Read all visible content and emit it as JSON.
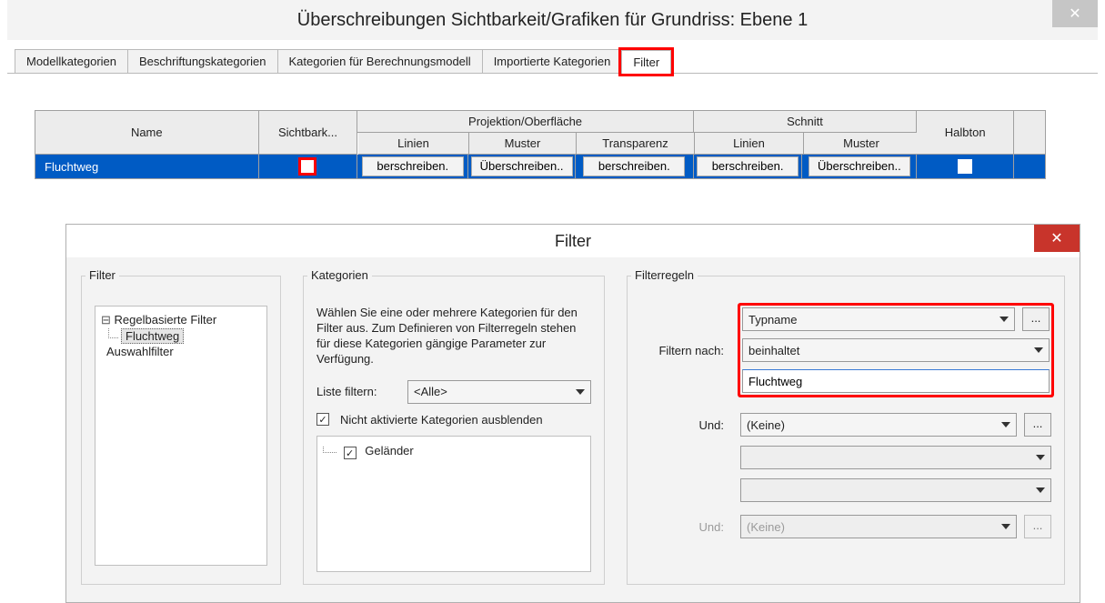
{
  "vg": {
    "title": "Überschreibungen Sichtbarkeit/Grafiken für Grundriss: Ebene 1",
    "close_icon": "✕",
    "tabs": [
      {
        "label": "Modellkategorien"
      },
      {
        "label": "Beschriftungskategorien"
      },
      {
        "label": "Kategorien für Berechnungsmodell"
      },
      {
        "label": "Importierte Kategorien"
      },
      {
        "label": "Filter"
      }
    ],
    "headers": {
      "name": "Name",
      "visibility": "Sichtbark...",
      "projection_group": "Projektion/Oberfläche",
      "proj_lines": "Linien",
      "proj_patterns": "Muster",
      "proj_transparency": "Transparenz",
      "cut_group": "Schnitt",
      "cut_lines": "Linien",
      "cut_patterns": "Muster",
      "halftone": "Halbton"
    },
    "row": {
      "name": "Fluchtweg",
      "proj_lines_btn": "berschreiben.",
      "proj_patterns_btn": "Überschreiben..",
      "proj_transp_btn": "berschreiben.",
      "cut_lines_btn": "berschreiben.",
      "cut_patterns_btn": "Überschreiben.."
    }
  },
  "fd": {
    "title": "Filter",
    "close_icon": "✕",
    "group_filter": "Filter",
    "group_categories": "Kategorien",
    "group_rules": "Filterregeln",
    "tree_root": "Regelbasierte Filter",
    "tree_child": "Fluchtweg",
    "tree_aux": "Auswahlfilter",
    "cat_help": "Wählen Sie eine oder mehrere Kategorien für den Filter aus. Zum Definieren von Filterregeln stehen für diese Kategorien gängige Parameter zur Verfügung.",
    "list_filter_label": "Liste filtern:",
    "list_filter_value": "<Alle>",
    "hide_unchecked_label": "Nicht aktivierte Kategorien ausblenden",
    "cat_item": "Geländer",
    "filter_by_label": "Filtern nach:",
    "filter_by_value": "Typname",
    "operator_value": "beinhaltet",
    "value_text": "Fluchtweg",
    "and_label": "Und:",
    "none_value": "(Keine)",
    "ellipsis": "..."
  }
}
